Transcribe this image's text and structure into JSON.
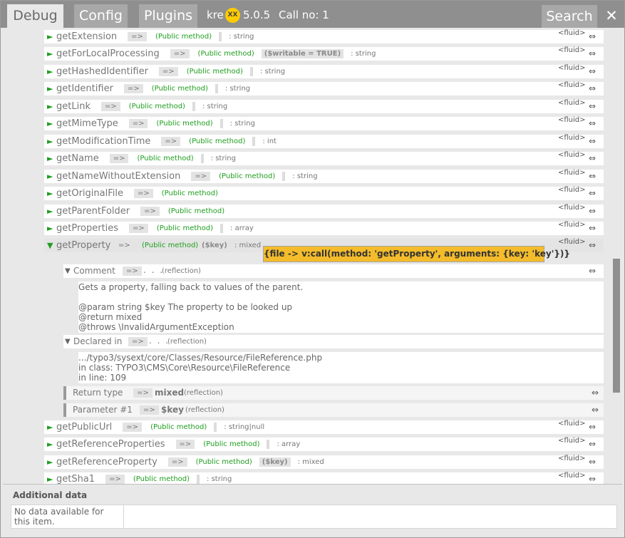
{
  "header": {
    "tabs": [
      "Debug",
      "Config",
      "Plugins"
    ],
    "brand_prefix": "kre",
    "brand_logo": "XX",
    "version": "5.0.5",
    "call_no": "Call no: 1",
    "search_label": "Search",
    "close_glyph": "✕"
  },
  "common": {
    "op": "=>",
    "public_method": "(Public method)",
    "fluid": "<fluid>",
    "dots": "⇔",
    "arrow_right": "►",
    "arrow_down": "▼",
    "ellipsis": ". . .",
    "reflection": "(reflection)"
  },
  "methods_top": [
    {
      "name": "getExtension",
      "arg": "",
      "rtype": ": string"
    },
    {
      "name": "getForLocalProcessing",
      "arg": "($writable = TRUE)",
      "rtype": ": string"
    },
    {
      "name": "getHashedIdentifier",
      "arg": "",
      "rtype": ": string"
    },
    {
      "name": "getIdentifier",
      "arg": "",
      "rtype": ": string"
    },
    {
      "name": "getLink",
      "arg": "",
      "rtype": ": string"
    },
    {
      "name": "getMimeType",
      "arg": "",
      "rtype": ": string"
    },
    {
      "name": "getModificationTime",
      "arg": "",
      "rtype": ": int"
    },
    {
      "name": "getName",
      "arg": "",
      "rtype": ": string"
    },
    {
      "name": "getNameWithoutExtension",
      "arg": "",
      "rtype": ": string"
    },
    {
      "name": "getOriginalFile",
      "arg": "",
      "rtype": ""
    },
    {
      "name": "getParentFolder",
      "arg": "",
      "rtype": ""
    },
    {
      "name": "getProperties",
      "arg": "",
      "rtype": ": array"
    }
  ],
  "expanded": {
    "name": "getProperty",
    "arg": "($key)",
    "rtype": ": mixed",
    "tooltip": "{file -> v:call(method: 'getProperty', arguments: {key: 'key'})}",
    "comment_label": "Comment",
    "comment_lines": [
      "Gets a property, falling back to values of the parent.",
      "",
      "@param string $key The property to be looked up",
      "@return mixed",
      "@throws \\InvalidArgumentException"
    ],
    "declared_label": "Declared in",
    "declared_lines": [
      ".../typo3/sysext/core/Classes/Resource/FileReference.php",
      "in class: TYPO3\\CMS\\Core\\Resource\\FileReference",
      "in line: 109"
    ],
    "return_label": "Return type",
    "return_value": "mixed",
    "param_label": "Parameter #1",
    "param_value": "$key"
  },
  "methods_bottom": [
    {
      "name": "getPublicUrl",
      "arg": "",
      "rtype": ": string|null"
    },
    {
      "name": "getReferenceProperties",
      "arg": "",
      "rtype": ": array"
    },
    {
      "name": "getReferenceProperty",
      "arg": "($key)",
      "rtype": ": mixed"
    },
    {
      "name": "getSha1",
      "arg": "",
      "rtype": ": string"
    }
  ],
  "additional": {
    "title": "Additional data",
    "message": "No data available for this item."
  }
}
